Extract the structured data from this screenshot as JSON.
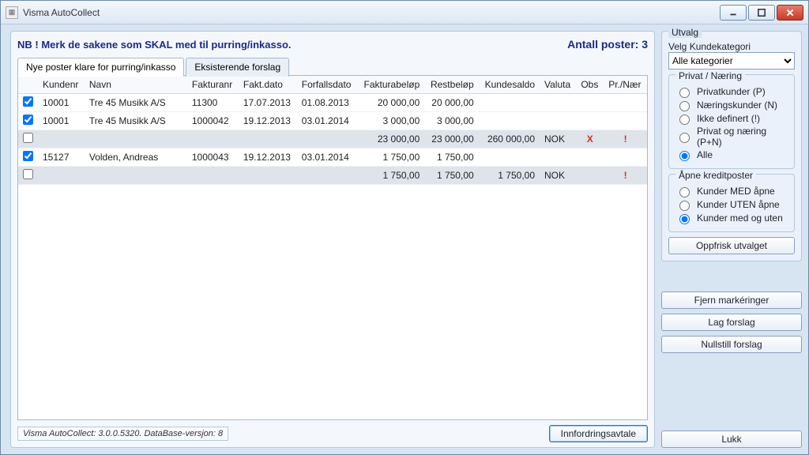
{
  "window": {
    "title": "Visma AutoCollect"
  },
  "header": {
    "nb_text": "NB ! Merk de sakene som SKAL med til purring/inkasso.",
    "count_label": "Antall poster: 3"
  },
  "tabs": {
    "active": "Nye poster klare for purring/inkasso",
    "other": "Eksisterende forslag"
  },
  "columns": {
    "kundenr": "Kundenr",
    "navn": "Navn",
    "fakturanr": "Fakturanr",
    "faktdato": "Fakt.dato",
    "forfallsdato": "Forfallsdato",
    "fakturabelop": "Fakturabeløp",
    "restbelop": "Restbeløp",
    "kundesaldo": "Kundesaldo",
    "valuta": "Valuta",
    "obs": "Obs",
    "prnaer": "Pr./Nær"
  },
  "rows": [
    {
      "chk": true,
      "kundenr": "10001",
      "navn": "Tre 45 Musikk A/S",
      "fakturanr": "11300",
      "faktdato": "17.07.2013",
      "forfallsdato": "01.08.2013",
      "fakturabelop": "20 000,00",
      "restbelop": "20 000,00",
      "kundesaldo": "",
      "valuta": "",
      "obs": "",
      "prnaer": "",
      "total": false
    },
    {
      "chk": true,
      "kundenr": "10001",
      "navn": "Tre 45 Musikk A/S",
      "fakturanr": "1000042",
      "faktdato": "19.12.2013",
      "forfallsdato": "03.01.2014",
      "fakturabelop": "3 000,00",
      "restbelop": "3 000,00",
      "kundesaldo": "",
      "valuta": "",
      "obs": "",
      "prnaer": "",
      "total": false
    },
    {
      "chk": false,
      "kundenr": "",
      "navn": "",
      "fakturanr": "",
      "faktdato": "",
      "forfallsdato": "",
      "fakturabelop": "23 000,00",
      "restbelop": "23 000,00",
      "kundesaldo": "260 000,00",
      "valuta": "NOK",
      "obs": "X",
      "prnaer": "!",
      "total": true
    },
    {
      "chk": true,
      "kundenr": "15127",
      "navn": "Volden, Andreas",
      "fakturanr": "1000043",
      "faktdato": "19.12.2013",
      "forfallsdato": "03.01.2014",
      "fakturabelop": "1 750,00",
      "restbelop": "1 750,00",
      "kundesaldo": "",
      "valuta": "",
      "obs": "",
      "prnaer": "",
      "total": false
    },
    {
      "chk": false,
      "kundenr": "",
      "navn": "",
      "fakturanr": "",
      "faktdato": "",
      "forfallsdato": "",
      "fakturabelop": "1 750,00",
      "restbelop": "1 750,00",
      "kundesaldo": "1 750,00",
      "valuta": "NOK",
      "obs": "",
      "prnaer": "!",
      "total": true
    }
  ],
  "status": "Visma AutoCollect: 3.0.0.5320. DataBase-versjon: 8",
  "buttons": {
    "innfordringsavtale": "Innfordringsavtale",
    "oppfrisk": "Oppfrisk utvalget",
    "fjern": "Fjern markéringer",
    "lag": "Lag forslag",
    "nullstill": "Nullstill forslag",
    "lukk": "Lukk"
  },
  "side": {
    "utvalg_title": "Utvalg",
    "velg_label": "Velg Kundekategori",
    "kategori_selected": "Alle kategorier",
    "privat_title": "Privat / Næring",
    "privat_options": {
      "p": "Privatkunder (P)",
      "n": "Næringskunder (N)",
      "i": "Ikke definert (!)",
      "pn": "Privat og næring (P+N)",
      "alle": "Alle"
    },
    "kredit_title": "Åpne kreditposter",
    "kredit_options": {
      "med": "Kunder MED åpne",
      "uten": "Kunder UTEN åpne",
      "begge": "Kunder med og uten"
    }
  }
}
